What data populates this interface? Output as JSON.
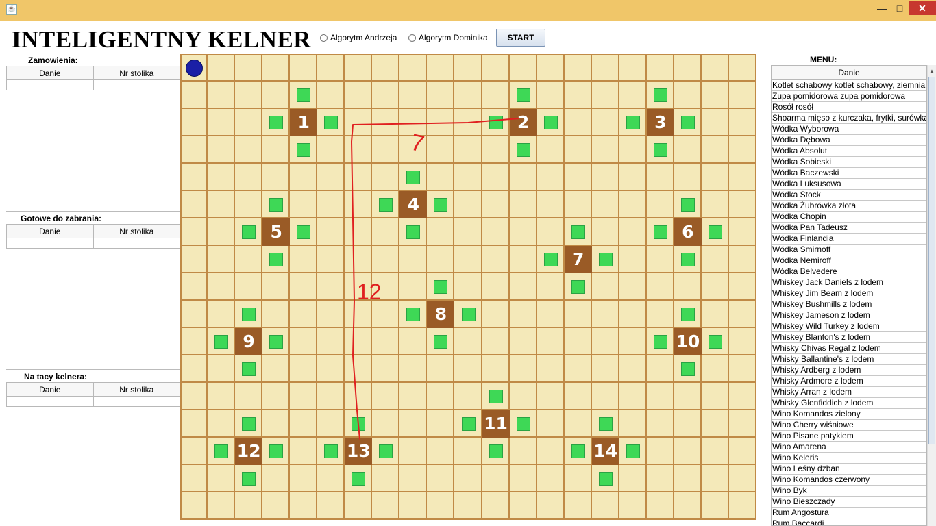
{
  "window": {
    "app_icon": "java-icon",
    "minimize": "—",
    "maximize": "□",
    "close": "✕"
  },
  "app_title": "INTELIGENTNY KELNER",
  "controls": {
    "radio1_label": "Algorytm Andrzeja",
    "radio2_label": "Algorytm Dominika",
    "start_label": "START"
  },
  "orders": {
    "title": "Zamowienia:",
    "col1": "Danie",
    "col2": "Nr stolika"
  },
  "ready": {
    "title": "Gotowe do zabrania:",
    "col1": "Danie",
    "col2": "Nr stolika"
  },
  "tray": {
    "title": "Na tacy kelnera:",
    "col1": "Danie",
    "col2": "Nr stolika"
  },
  "board": {
    "cols": 21,
    "rows": 17,
    "tables": [
      {
        "label": "1",
        "col": 4,
        "row": 2
      },
      {
        "label": "2",
        "col": 12,
        "row": 2
      },
      {
        "label": "3",
        "col": 17,
        "row": 2
      },
      {
        "label": "4",
        "col": 8,
        "row": 5
      },
      {
        "label": "5",
        "col": 3,
        "row": 6
      },
      {
        "label": "6",
        "col": 18,
        "row": 6
      },
      {
        "label": "7",
        "col": 14,
        "row": 7
      },
      {
        "label": "8",
        "col": 9,
        "row": 9
      },
      {
        "label": "9",
        "col": 2,
        "row": 10
      },
      {
        "label": "10",
        "col": 18,
        "row": 10
      },
      {
        "label": "11",
        "col": 11,
        "row": 13
      },
      {
        "label": "12",
        "col": 2,
        "row": 14
      },
      {
        "label": "13",
        "col": 6,
        "row": 14
      },
      {
        "label": "14",
        "col": 15,
        "row": 14
      }
    ],
    "chairs": [
      [
        4,
        1
      ],
      [
        12,
        1
      ],
      [
        17,
        1
      ],
      [
        3,
        2
      ],
      [
        5,
        2
      ],
      [
        11,
        2
      ],
      [
        13,
        2
      ],
      [
        16,
        2
      ],
      [
        18,
        2
      ],
      [
        4,
        3
      ],
      [
        12,
        3
      ],
      [
        17,
        3
      ],
      [
        8,
        4
      ],
      [
        3,
        5
      ],
      [
        7,
        5
      ],
      [
        9,
        5
      ],
      [
        18,
        5
      ],
      [
        2,
        6
      ],
      [
        4,
        6
      ],
      [
        8,
        6
      ],
      [
        14,
        6
      ],
      [
        17,
        6
      ],
      [
        19,
        6
      ],
      [
        3,
        7
      ],
      [
        13,
        7
      ],
      [
        15,
        7
      ],
      [
        18,
        7
      ],
      [
        9,
        8
      ],
      [
        14,
        8
      ],
      [
        2,
        9
      ],
      [
        8,
        9
      ],
      [
        10,
        9
      ],
      [
        18,
        9
      ],
      [
        1,
        10
      ],
      [
        3,
        10
      ],
      [
        9,
        10
      ],
      [
        17,
        10
      ],
      [
        19,
        10
      ],
      [
        2,
        11
      ],
      [
        18,
        11
      ],
      [
        11,
        12
      ],
      [
        2,
        13
      ],
      [
        6,
        13
      ],
      [
        10,
        13
      ],
      [
        12,
        13
      ],
      [
        15,
        13
      ],
      [
        1,
        14
      ],
      [
        3,
        14
      ],
      [
        5,
        14
      ],
      [
        7,
        14
      ],
      [
        11,
        14
      ],
      [
        14,
        14
      ],
      [
        16,
        14
      ],
      [
        2,
        15
      ],
      [
        6,
        15
      ],
      [
        15,
        15
      ]
    ],
    "waiter": {
      "col": 0,
      "row": 0
    },
    "scribbles": {
      "annotation_1": "7",
      "annotation_2": "12",
      "stroke_color": "#e02020"
    }
  },
  "menu": {
    "title": "MENU:",
    "header": "Danie",
    "items": [
      "Kotlet schabowy kotlet schabowy, ziemniaki, surówka",
      "Zupa pomidorowa zupa pomidorowa",
      "Rosół rosół",
      "Shoarma mięso z kurczaka, frytki, surówka",
      "Wódka Wyborowa",
      "Wódka Dębowa",
      "Wódka Absolut",
      "Wódka Sobieski",
      "Wódka Baczewski",
      "Wódka Luksusowa",
      "Wódka Stock",
      "Wódka Żubrówka złota",
      "Wódka Chopin",
      "Wódka Pan Tadeusz",
      "Wódka Finlandia",
      "Wódka Smirnoff",
      "Wódka Nemiroff",
      "Wódka Belvedere",
      "Whiskey Jack Daniels z lodem",
      "Whiskey Jim Beam z lodem",
      "Whiskey Bushmills z lodem",
      "Whiskey Jameson z lodem",
      "Whiskey Wild Turkey z lodem",
      "Whiskey Blanton's z lodem",
      "Whisky Chivas Regal z lodem",
      "Whisky Ballantine's z lodem",
      "Whisky Ardberg z lodem",
      "Whisky Ardmore z lodem",
      "Whisky Arran z lodem",
      "Whisky Glenfiddich z lodem",
      "Wino Komandos zielony",
      "Wino Cherry wiśniowe",
      "Wino Pisane patykiem",
      "Wino Amarena",
      "Wino Keleris",
      "Wino Leśny dzban",
      "Wino Komandos czerwony",
      "Wino Byk",
      "Wino Bieszczady",
      "Rum Angostura",
      "Rum Baccardi"
    ]
  },
  "colors": {
    "board_bg": "#f4e9b9",
    "grid_line": "#c08a46",
    "table": "#9a5b26",
    "chair": "#3ed856",
    "waiter": "#1a1fa6"
  }
}
